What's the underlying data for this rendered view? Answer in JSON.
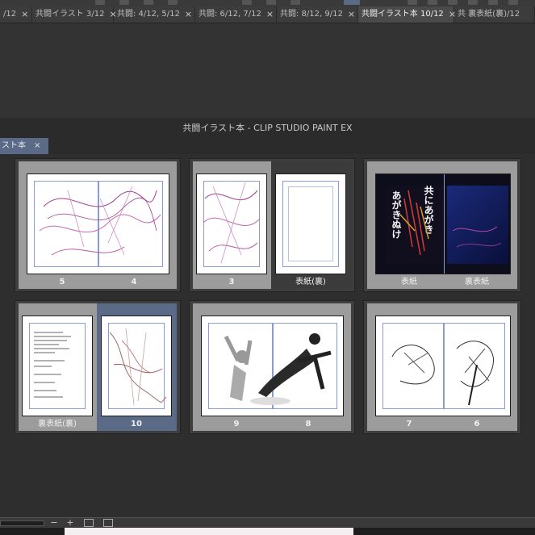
{
  "tabs": [
    {
      "label": "/12",
      "active": false
    },
    {
      "label": "共闘イラスト 3/12",
      "active": false
    },
    {
      "label": "共闘: 4/12, 5/12",
      "active": false
    },
    {
      "label": "共闘: 6/12, 7/12",
      "active": false
    },
    {
      "label": "共闘: 8/12, 9/12",
      "active": false
    },
    {
      "label": "共闘イラスト本 10/12",
      "active": true
    },
    {
      "label": "共 裏表紙(裏)/12",
      "active": false
    }
  ],
  "close_glyph": "×",
  "window_title": "共闘イラスト本 - CLIP STUDIO PAINT EX",
  "panel_tab": {
    "label": "スト本"
  },
  "pages": {
    "p5": "5",
    "p4": "4",
    "p3": "3",
    "p_cover_back_inner": "表紙(裏)",
    "p_cover": "表紙",
    "p_back_cover": "裏表紙",
    "p_back_inner": "裏表紙(裏)",
    "p10": "10",
    "p9": "9",
    "p8": "8",
    "p7": "7",
    "p6": "6"
  },
  "cover_art_text": {
    "line1": "共にあがき",
    "line2": "あがきぬけ"
  },
  "status": {
    "zoom_out": "−",
    "zoom_in": "+"
  },
  "colors": {
    "accent": "#5b6a87",
    "panel_bg": "#2e2e2e"
  }
}
